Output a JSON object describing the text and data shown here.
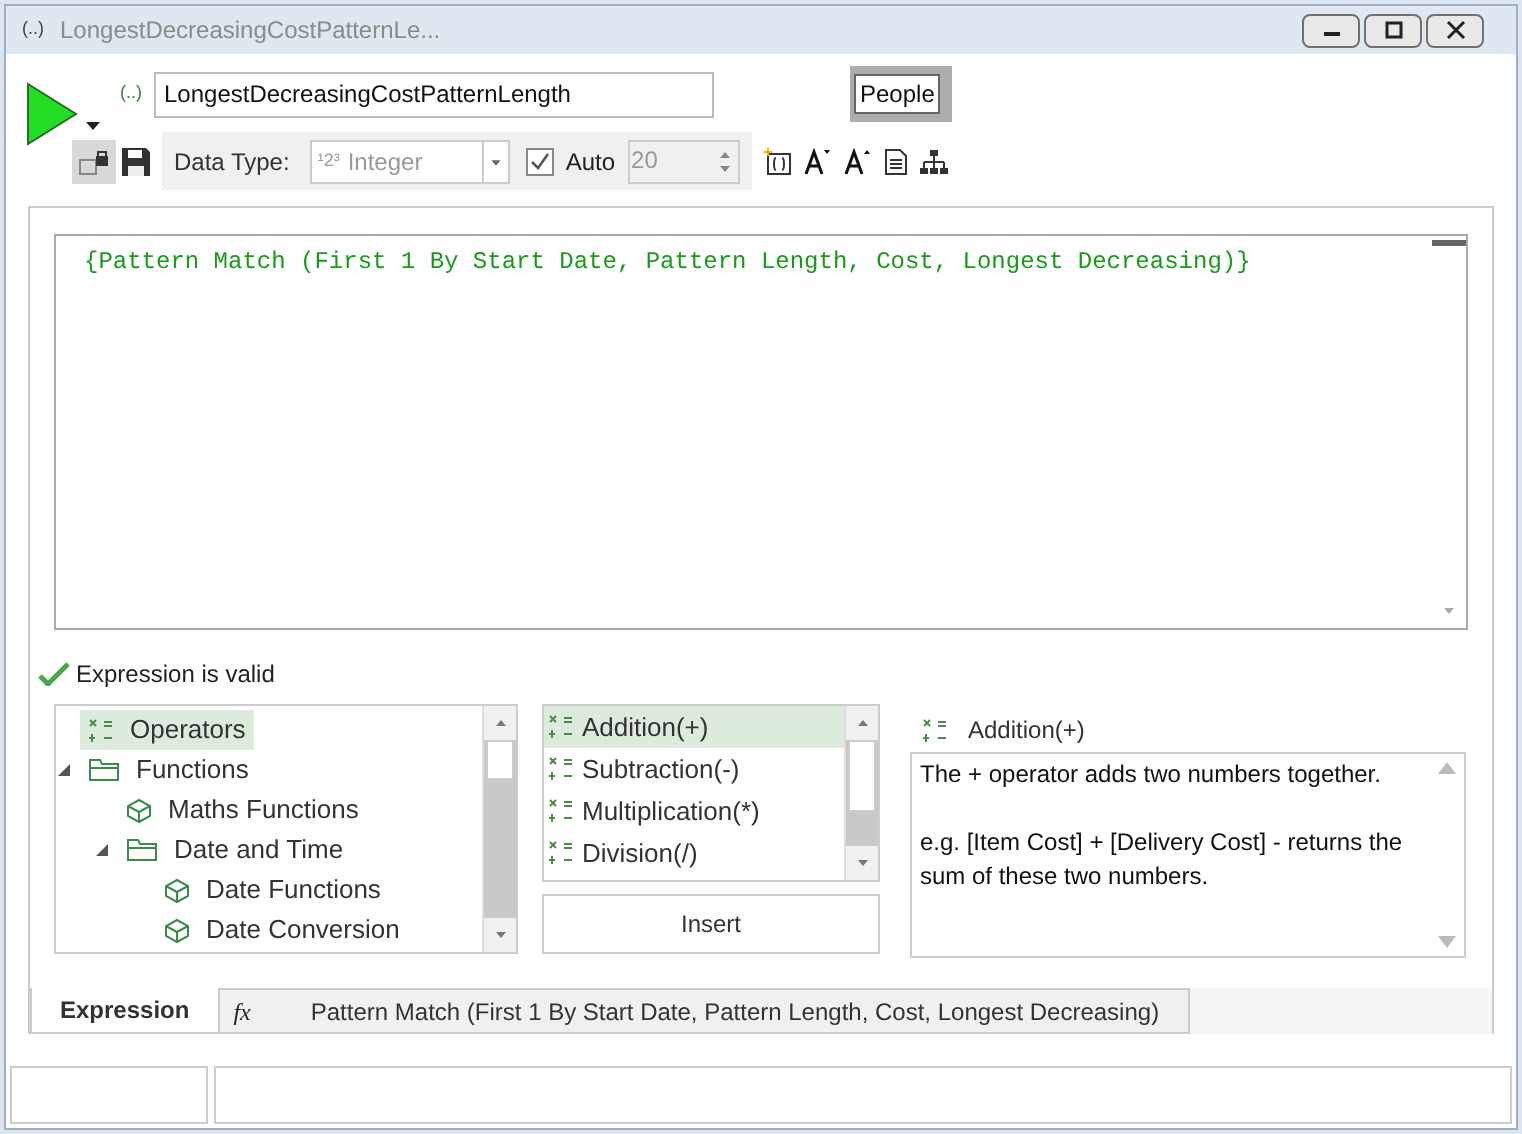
{
  "window": {
    "title": "LongestDecreasingCostPatternLe...",
    "title_badge": "(..)"
  },
  "header": {
    "name_badge": "(..)",
    "name_value": "LongestDecreasingCostPatternLength",
    "people_button": "People"
  },
  "toolbar": {
    "data_type_label": "Data Type:",
    "type_badge": "¹2³",
    "data_type_value": "Integer",
    "auto": {
      "label": "Auto",
      "checked": true
    },
    "size": {
      "value": "20",
      "disabled": true
    }
  },
  "editor": {
    "code": "{Pattern Match (First 1 By Start Date, Pattern Length, Cost, Longest Decreasing)}"
  },
  "validation": {
    "valid": true,
    "message": "Expression is valid"
  },
  "tree": [
    {
      "label": "Operators",
      "kind": "operator",
      "selected": true
    },
    {
      "label": "Functions",
      "kind": "folder",
      "selected": false,
      "expanded": true,
      "children": [
        {
          "label": "Maths Functions",
          "kind": "function",
          "selected": false
        },
        {
          "label": "Date and Time",
          "kind": "folder",
          "selected": false,
          "expanded": true,
          "children": [
            {
              "label": "Date Functions",
              "kind": "function",
              "selected": false
            },
            {
              "label": "Date Conversion",
              "kind": "function",
              "selected": false
            }
          ]
        }
      ]
    }
  ],
  "operators": [
    {
      "label": "Addition(+)",
      "selected": true
    },
    {
      "label": "Subtraction(-)",
      "selected": false
    },
    {
      "label": "Multiplication(*)",
      "selected": false
    },
    {
      "label": "Division(/)",
      "selected": false
    }
  ],
  "insert_button": "Insert",
  "description": {
    "title": "Addition(+)",
    "paragraphs": [
      "The + operator adds two numbers together.",
      "e.g. [Item Cost] + [Delivery Cost] - returns the sum of these two numbers."
    ]
  },
  "tabs": [
    {
      "label": "Expression",
      "selected": true
    },
    {
      "label": "Pattern Match (First 1 By Start Date, Pattern Length, Cost, Longest Decreasing)",
      "icon": "fx",
      "selected": false
    }
  ]
}
